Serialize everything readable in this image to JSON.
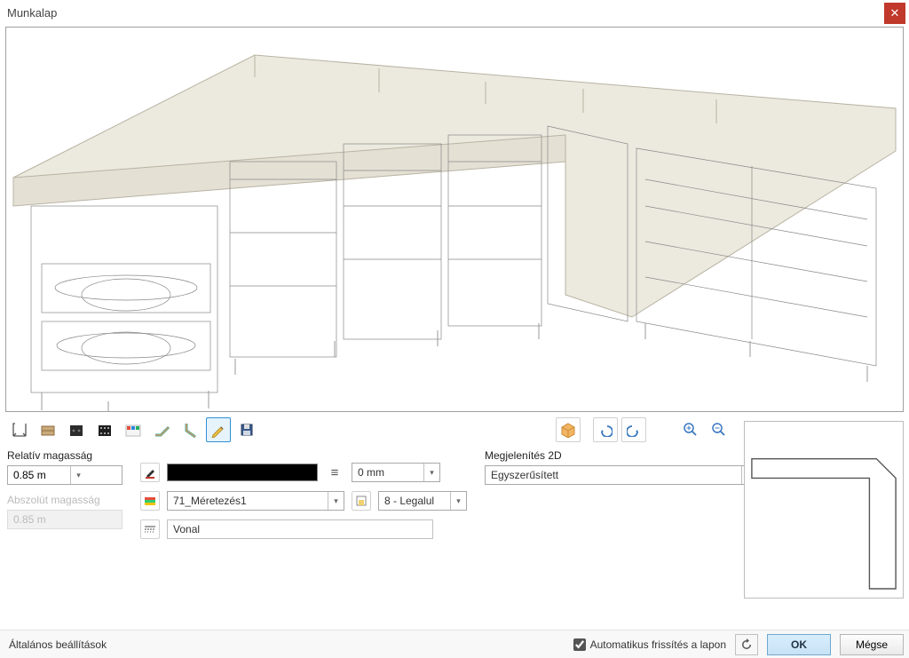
{
  "window": {
    "title": "Munkalap"
  },
  "toolbar": {
    "items": [
      "dimension-icon",
      "texture-icon",
      "tile-dark-icon",
      "tile-dots-icon",
      "palette-icon",
      "edge-icon",
      "edge-v-icon",
      "pencil-icon",
      "save-icon"
    ],
    "selected_index": 7,
    "right_items": [
      "cube-orange-icon",
      "undo-icon",
      "redo-icon",
      "zoom-in-icon",
      "zoom-out-icon"
    ]
  },
  "params": {
    "rel_height_label": "Relatív magasság",
    "rel_height_value": "0.85 m",
    "abs_height_label": "Abszolút magasság",
    "abs_height_value": "0.85 m",
    "layer_value": "71_Méretezés1",
    "line_label": "Vonal",
    "thickness_value": "0 mm",
    "priority_value": "8 - Legalul",
    "display2d_label": "Megjelenítés 2D",
    "display2d_value": "Egyszerűsített"
  },
  "bottom": {
    "general_settings": "Általános beállítások",
    "auto_refresh": "Automatikus frissítés a lapon",
    "ok": "OK",
    "cancel": "Mégse"
  }
}
